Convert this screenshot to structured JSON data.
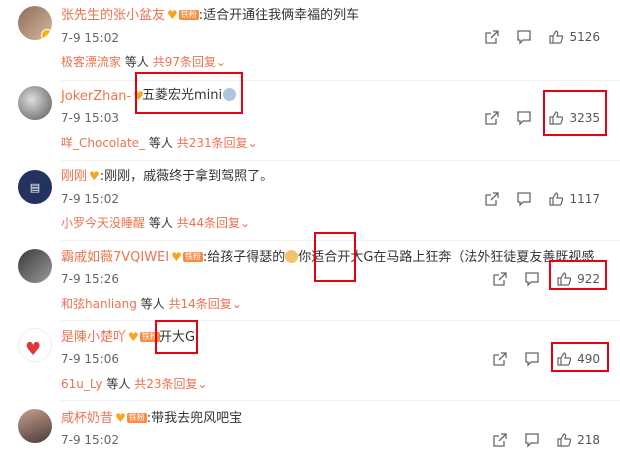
{
  "comments": [
    {
      "user": "张先生的张小盆友",
      "fan_label": "铁粉",
      "text": ":适合开通往我俩幸福的列车",
      "time": "7-9 15:02",
      "likes": "5126",
      "reply_user": "极客漂流家",
      "reply_mid": "等人",
      "reply_total": "共97条回复"
    },
    {
      "user": "JokerZhan-",
      "fan_label": "",
      "text": "五菱宏光mini",
      "time": "7-9 15:03",
      "likes": "3235",
      "reply_user": "咩_Chocolate_",
      "reply_mid": "等人",
      "reply_total": "共231条回复"
    },
    {
      "user": "刚刚",
      "fan_label": "",
      "text": ":刚刚，戚薇终于拿到驾照了。",
      "time": "7-9 15:02",
      "likes": "1117",
      "reply_user": "小罗今天没睡醒",
      "reply_mid": "等人",
      "reply_total": "共44条回复"
    },
    {
      "user": "霸戚如薇7VQIWEI",
      "fan_label": "铁粉",
      "text_a": ":给孩子得瑟的",
      "text_b": "你适合",
      "text_c": "开大G",
      "text_d": "在马路上狂奔（法外狂徒夏友善既视感",
      "time": "7-9 15:26",
      "likes": "922",
      "reply_user": "和弦hanliang",
      "reply_mid": "等人",
      "reply_total": "共14条回复"
    },
    {
      "user": "是陳小楚吖",
      "fan_label": "铁粉",
      "text": "开大G",
      "time": "7-9 15:06",
      "likes": "490",
      "reply_user": "61u_Ly",
      "reply_mid": "等人",
      "reply_total": "共23条回复"
    },
    {
      "user": "咸杯奶昔",
      "fan_label": "铁粉",
      "text": ":带我去兜风吧宝",
      "time": "7-9 15:02",
      "likes": "218"
    }
  ],
  "colors": {
    "username": "#eb7350",
    "highlight_box": "#e60012",
    "fan_badge": "#ff8a3d"
  },
  "icons": {
    "share": "share-icon",
    "comment": "comment-icon",
    "like": "thumbs-up-icon"
  }
}
